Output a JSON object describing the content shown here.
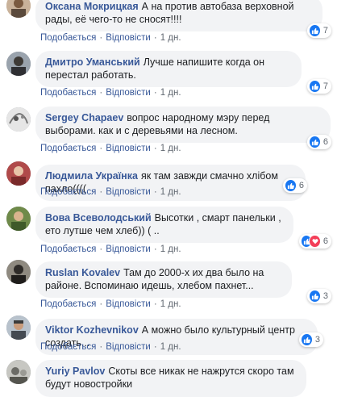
{
  "actions": {
    "like_label": "Подобається",
    "separator": "·",
    "reply_label": "Відповісти",
    "age": "1 дн."
  },
  "colors": {
    "author": "#385898",
    "bubble": "#f2f3f5",
    "like": "#1877f2",
    "love": "#f33e58"
  },
  "comments": [
    {
      "author": "Оксана Мокрицкая",
      "text": "А на против автобаза верховной рады, её чего-то не сносят!!!!",
      "reactions": {
        "types": [
          "like-icon"
        ],
        "count": "7"
      }
    },
    {
      "author": "Дмитро Уманський",
      "text": "Лучше напишите когда он перестал работать.",
      "reactions": {
        "types": [
          "like-icon"
        ],
        "count": "7"
      }
    },
    {
      "author": "Sergey Chapaev",
      "text": "вопрос народному мэру перед выборами. как и с деревьями на лесном.",
      "reactions": {
        "types": [
          "like-icon"
        ],
        "count": "6"
      }
    },
    {
      "author": "Людмила Українка",
      "text": "як там завжди смачно хлібом пахло((((",
      "reactions": {
        "types": [
          "like-icon"
        ],
        "count": "6"
      }
    },
    {
      "author": "Вова Всеволодський",
      "text": "Высотки , смарт панельки , ето лутше чем хлеб)) ( ..",
      "reactions": {
        "types": [
          "like-icon",
          "love-icon"
        ],
        "count": "6"
      }
    },
    {
      "author": "Ruslan Kovalev",
      "text": "Там до 2000-х их два было на районе. Вспоминаю идешь, хлебом пахнет...",
      "reactions": {
        "types": [
          "like-icon"
        ],
        "count": "3"
      }
    },
    {
      "author": "Viktor Kozhevnikov",
      "text": "А можно было культурный центр создать...",
      "reactions": {
        "types": [
          "like-icon"
        ],
        "count": "3"
      }
    },
    {
      "author": "Yuriy Pavlov",
      "text": "Скоты все никак не нажрутся скоро там будут новостройки",
      "reactions": null
    }
  ]
}
